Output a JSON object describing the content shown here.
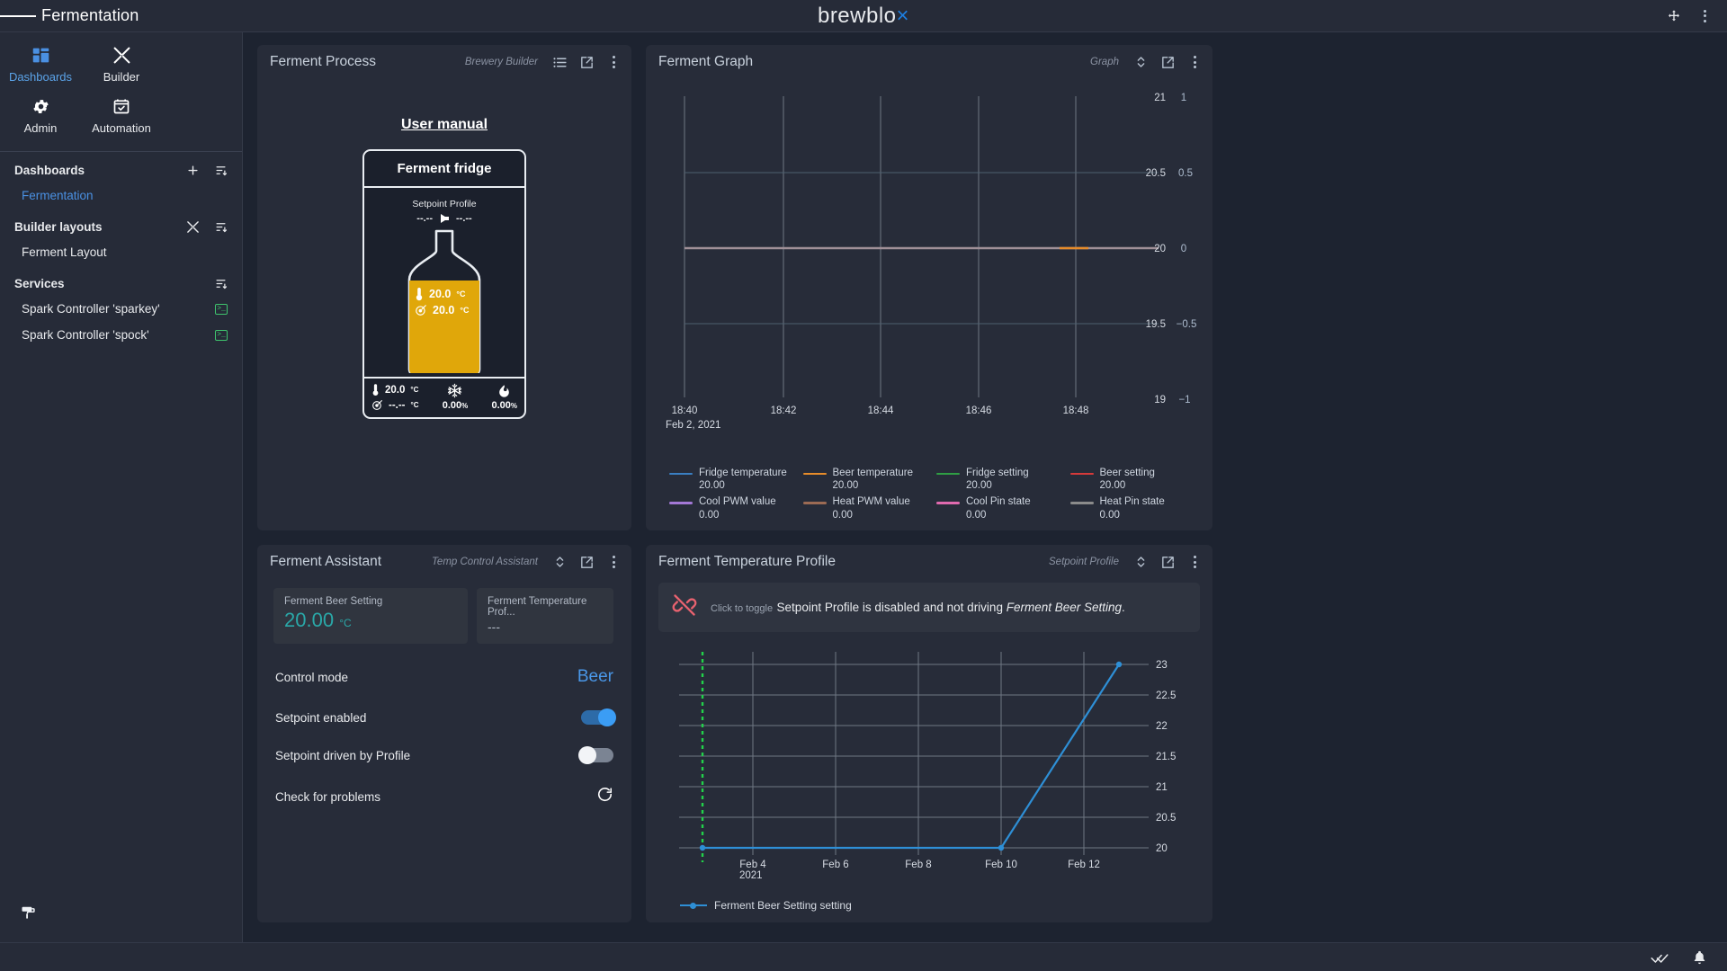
{
  "topbar": {
    "title": "Fermentation",
    "brand_main": "brewblo",
    "brand_x": "x",
    "menu_icon": "hamburger-icon",
    "move_icon": "move-icon",
    "kebab_icon": "more-vertical-icon"
  },
  "sidebar": {
    "nav": [
      {
        "label": "Dashboards",
        "icon": "dashboard-grid-icon",
        "active": true
      },
      {
        "label": "Builder",
        "icon": "tools-icon",
        "active": false
      },
      {
        "label": "Admin",
        "icon": "gear-icon",
        "active": false
      },
      {
        "label": "Automation",
        "icon": "calendar-check-icon",
        "active": false
      }
    ],
    "sections": [
      {
        "title": "Dashboards",
        "actions": [
          "plus-icon",
          "sort-icon"
        ],
        "items": [
          {
            "label": "Fermentation",
            "selected": true,
            "badge": ""
          }
        ]
      },
      {
        "title": "Builder layouts",
        "actions": [
          "tools-icon",
          "sort-icon"
        ],
        "items": [
          {
            "label": "Ferment Layout",
            "selected": false,
            "badge": ""
          }
        ]
      },
      {
        "title": "Services",
        "actions": [
          "sort-icon"
        ],
        "items": [
          {
            "label": "Spark Controller 'sparkey'",
            "selected": false,
            "badge": "terminal-icon"
          },
          {
            "label": "Spark Controller 'spock'",
            "selected": false,
            "badge": "terminal-icon"
          }
        ]
      }
    ],
    "bottom_icon": "paint-roller-icon"
  },
  "widgets": {
    "process": {
      "title": "Ferment Process",
      "subtitle": "Brewery Builder",
      "icons": [
        "list-icon",
        "open-external-icon",
        "more-vertical-icon"
      ],
      "user_manual": "User manual",
      "fridge_name": "Ferment fridge",
      "setpoint_profile_label": "Setpoint Profile",
      "setpoint_from": "--.--",
      "setpoint_to": "--.--",
      "carboy": {
        "temp_value": "20.0",
        "temp_unit": "°C",
        "setting_value": "20.0",
        "setting_unit": "°C"
      },
      "footer": {
        "temp_value": "20.0",
        "temp_unit": "°C",
        "setting_value": "--.--",
        "setting_unit": "°C",
        "cool_pct": "0.00",
        "heat_pct": "0.00",
        "pct_unit": "%"
      }
    },
    "graph": {
      "title": "Ferment Graph",
      "subtitle": "Graph",
      "icons": [
        "expand-vertical-icon",
        "open-external-icon",
        "more-vertical-icon"
      ]
    },
    "assistant": {
      "title": "Ferment Assistant",
      "subtitle": "Temp Control Assistant",
      "icons": [
        "expand-vertical-icon",
        "open-external-icon",
        "more-vertical-icon"
      ],
      "cards": [
        {
          "label": "Ferment Beer Setting",
          "value": "20.00",
          "unit": "°C",
          "dim": false
        },
        {
          "label": "Ferment Temperature Prof...",
          "value": "---",
          "unit": "",
          "dim": true
        }
      ],
      "rows": [
        {
          "label": "Control mode",
          "kind": "text",
          "value": "Beer"
        },
        {
          "label": "Setpoint enabled",
          "kind": "toggle",
          "on": true
        },
        {
          "label": "Setpoint driven by Profile",
          "kind": "toggle",
          "on": false
        },
        {
          "label": "Check for problems",
          "kind": "icon",
          "icon": "refresh-icon"
        }
      ]
    },
    "profile": {
      "title": "Ferment Temperature Profile",
      "subtitle": "Setpoint Profile",
      "icons": [
        "expand-vertical-icon",
        "open-external-icon",
        "more-vertical-icon"
      ],
      "warning": {
        "icon": "broken-link-icon",
        "hint": "Click to toggle",
        "text_before": "Setpoint Profile is disabled and not driving ",
        "text_em": "Ferment Beer Setting",
        "text_after": "."
      }
    }
  },
  "bottombar": {
    "icons": [
      "double-check-icon",
      "bell-icon"
    ]
  },
  "chart_data": [
    {
      "type": "line",
      "id": "ferment-graph",
      "title": "Ferment Graph",
      "xlabel": "",
      "ylabel": "",
      "x_tick_labels": [
        "18:40",
        "18:42",
        "18:44",
        "18:46",
        "18:48"
      ],
      "x_date_label": "Feb 2, 2021",
      "y_left_ticks": [
        19,
        19.5,
        20,
        20.5,
        21
      ],
      "y_left_tick_labels": [
        "19",
        "19.5",
        "20",
        "20.5",
        "21"
      ],
      "y_right_ticks": [
        -1,
        -0.5,
        0,
        0.5,
        1
      ],
      "y_right_tick_labels": [
        "-1",
        "-0.5",
        "0",
        "0.5",
        "1"
      ],
      "ylim": [
        19,
        21
      ],
      "y2lim": [
        -1,
        1
      ],
      "grid": true,
      "legend_position": "bottom",
      "series": [
        {
          "name": "Fridge temperature",
          "value": "20.00",
          "color": "#3a7fc2",
          "axis": "left",
          "constant": 20.0
        },
        {
          "name": "Beer temperature",
          "value": "20.00",
          "color": "#e78c2a",
          "axis": "left",
          "constant": 20.0
        },
        {
          "name": "Fridge setting",
          "value": "20.00",
          "color": "#2f9e44",
          "axis": "left",
          "constant": 20.0
        },
        {
          "name": "Beer setting",
          "value": "20.00",
          "color": "#d63a3a",
          "axis": "left",
          "constant": 20.0
        },
        {
          "name": "Cool PWM value",
          "value": "0.00",
          "color": "#a378d6",
          "axis": "right",
          "constant": 0.0
        },
        {
          "name": "Heat PWM value",
          "value": "0.00",
          "color": "#9c6b54",
          "axis": "right",
          "constant": 0.0
        },
        {
          "name": "Cool Pin state",
          "value": "0.00",
          "color": "#e06aaf",
          "axis": "right",
          "constant": 0.0
        },
        {
          "name": "Heat Pin state",
          "value": "0.00",
          "color": "#8b8b8b",
          "axis": "right",
          "constant": 0.0
        }
      ]
    },
    {
      "type": "line",
      "id": "setpoint-profile",
      "title": "Ferment Temperature Profile",
      "xlabel": "",
      "ylabel": "",
      "x_tick_labels": [
        "Feb 4",
        "Feb 6",
        "Feb 8",
        "Feb 10",
        "Feb 12"
      ],
      "x_year_label": "2021",
      "y_ticks": [
        20,
        20.5,
        21,
        21.5,
        22,
        22.5,
        23
      ],
      "y_tick_labels": [
        "20",
        "20.5",
        "21",
        "21.5",
        "22",
        "22.5",
        "23"
      ],
      "ylim": [
        19.87,
        23.1
      ],
      "grid": true,
      "now_marker": {
        "label": "",
        "color": "#22d24a",
        "x": "Feb 3"
      },
      "legend_position": "bottom",
      "series": [
        {
          "name": "Ferment Beer Setting setting",
          "color": "#2e8fd6",
          "points": [
            {
              "x": "Feb 3",
              "y": 20
            },
            {
              "x": "Feb 9.8",
              "y": 20
            },
            {
              "x": "Feb 13",
              "y": 23
            }
          ]
        }
      ]
    }
  ]
}
